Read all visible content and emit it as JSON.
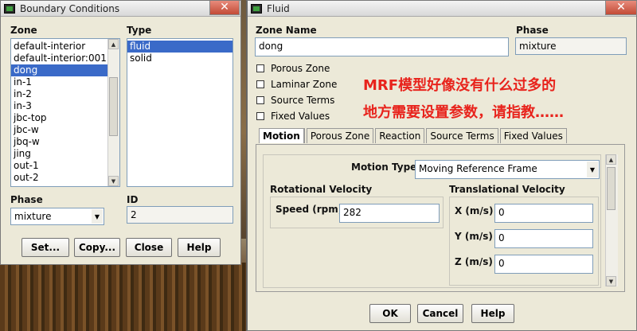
{
  "boundary": {
    "title": "Boundary Conditions",
    "zone_label": "Zone",
    "type_label": "Type",
    "zones": [
      "default-interior",
      "default-interior:001",
      "dong",
      "in-1",
      "in-2",
      "in-3",
      "jbc-top",
      "jbc-w",
      "jbq-w",
      "jing",
      "out-1",
      "out-2"
    ],
    "selected_zone": "dong",
    "types": [
      "fluid",
      "solid"
    ],
    "selected_type": "fluid",
    "phase_label": "Phase",
    "phase_value": "mixture",
    "id_label": "ID",
    "id_value": "2",
    "buttons": [
      "Set...",
      "Copy...",
      "Close",
      "Help"
    ]
  },
  "fluid": {
    "title": "Fluid",
    "zone_name_label": "Zone Name",
    "zone_name_value": "dong",
    "phase_label": "Phase",
    "phase_value": "mixture",
    "checkboxes": [
      "Porous Zone",
      "Laminar Zone",
      "Source Terms",
      "Fixed Values"
    ],
    "annotation_line1": "MRF模型好像没有什么过多的",
    "annotation_line2": "地方需要设置参数，请指教……",
    "tabs": [
      "Motion",
      "Porous Zone",
      "Reaction",
      "Source Terms",
      "Fixed Values"
    ],
    "active_tab": "Motion",
    "motion_type_label": "Motion Type",
    "motion_type_value": "Moving Reference Frame",
    "rotational_label": "Rotational Velocity",
    "speed_label": "Speed (rpm)",
    "speed_value": "282",
    "translational_label": "Translational Velocity",
    "x_label": "X (m/s)",
    "x_value": "0",
    "y_label": "Y (m/s)",
    "y_value": "0",
    "z_label": "Z (m/s)",
    "z_value": "0",
    "buttons": [
      "OK",
      "Cancel",
      "Help"
    ]
  },
  "colors": {
    "selection": "#3a6ac8",
    "annotation": "#e8231c",
    "dialog_bg": "#ece9d8"
  }
}
